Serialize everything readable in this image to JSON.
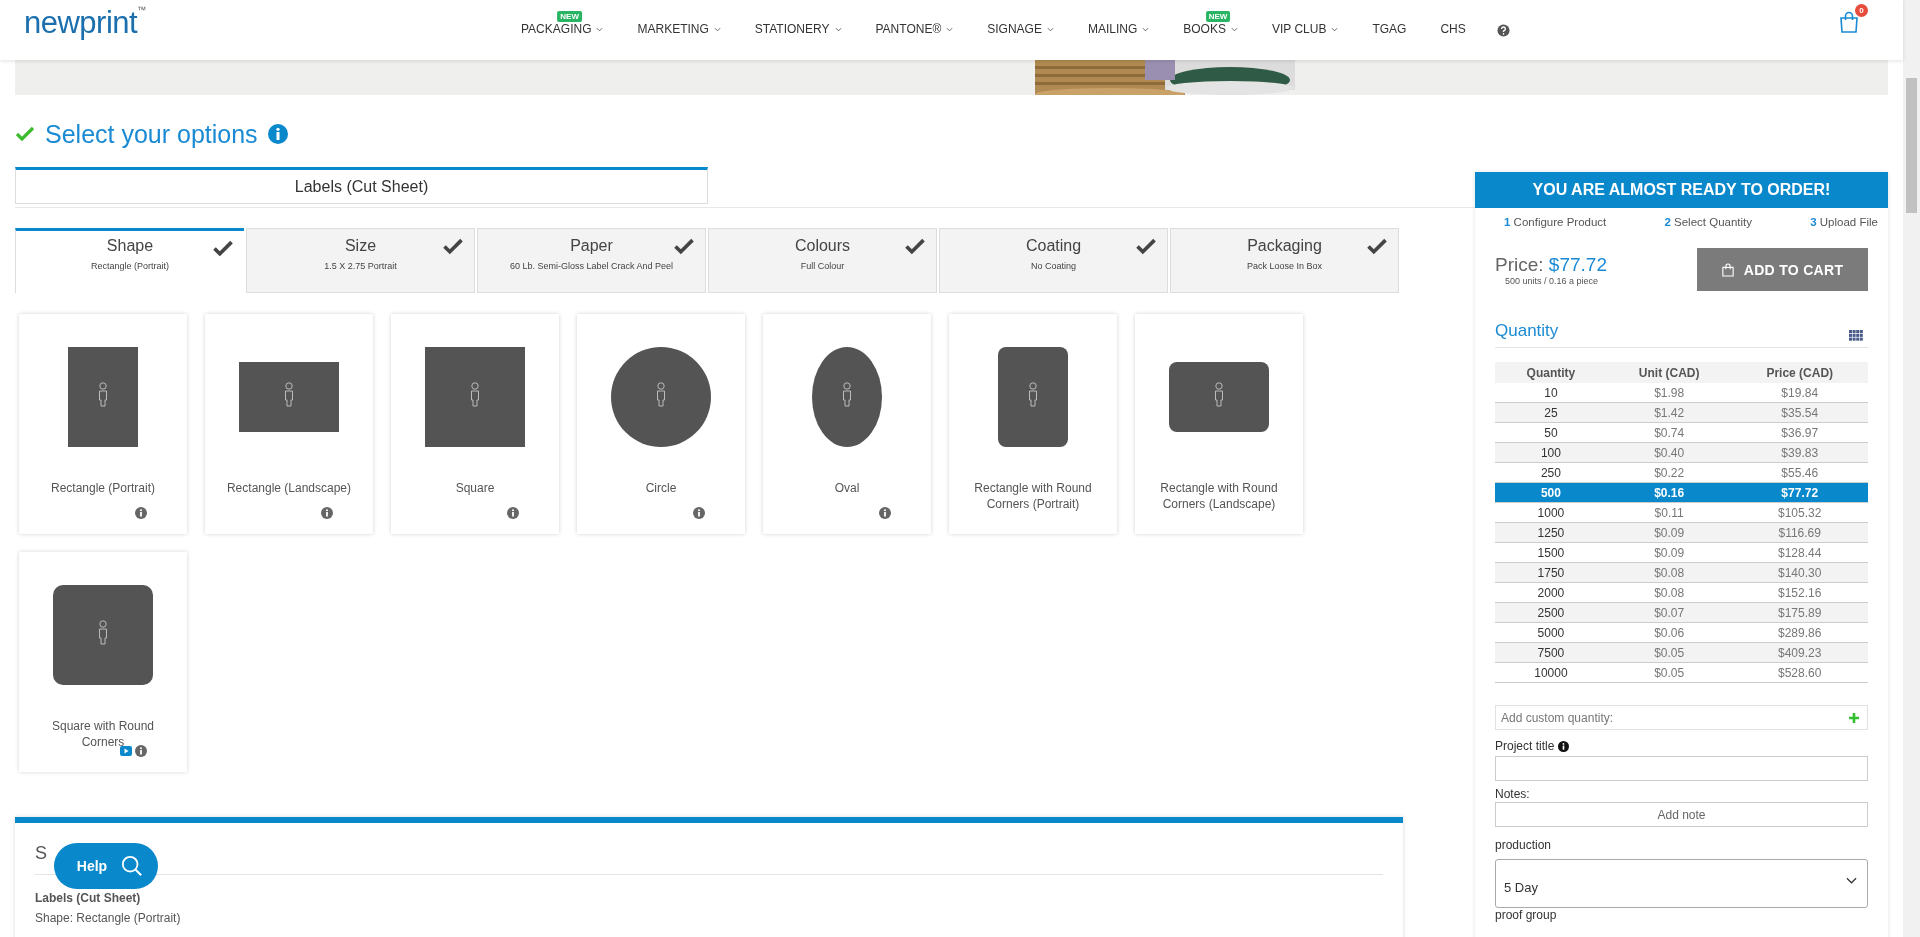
{
  "header": {
    "logo": "newprint",
    "logo_mark": "™",
    "nav": [
      {
        "label": "PACKAGING",
        "dropdown": true,
        "badge": "NEW"
      },
      {
        "label": "MARKETING",
        "dropdown": true
      },
      {
        "label": "STATIONERY",
        "dropdown": true
      },
      {
        "label": "PANTONE®",
        "dropdown": true
      },
      {
        "label": "SIGNAGE",
        "dropdown": true
      },
      {
        "label": "MAILING",
        "dropdown": true
      },
      {
        "label": "BOOKS",
        "dropdown": true,
        "badge": "NEW"
      },
      {
        "label": "VIP CLUB",
        "dropdown": true
      },
      {
        "label": "TGAG",
        "dropdown": false
      },
      {
        "label": "CHS",
        "dropdown": false
      }
    ],
    "cart_count": "0"
  },
  "options": {
    "title": "Select your options",
    "product_tab": "Labels (Cut Sheet)",
    "tabs": [
      {
        "title": "Shape",
        "value": "Rectangle (Portrait)",
        "selected": true,
        "completed": true
      },
      {
        "title": "Size",
        "value": "1.5 X 2.75 Portrait",
        "selected": false,
        "completed": true
      },
      {
        "title": "Paper",
        "value": "60 Lb. Semi-Gloss Label Crack And Peel",
        "selected": false,
        "completed": true
      },
      {
        "title": "Colours",
        "value": "Full Colour",
        "selected": false,
        "completed": true
      },
      {
        "title": "Coating",
        "value": "No Coating",
        "selected": false,
        "completed": true
      },
      {
        "title": "Packaging",
        "value": "Pack Loose In Box",
        "selected": false,
        "completed": true
      }
    ],
    "shapes": [
      {
        "label": "Rectangle (Portrait)",
        "kind": "rectangle-portrait",
        "info": true,
        "video": false
      },
      {
        "label": "Rectangle (Landscape)",
        "kind": "rectangle-landscape",
        "info": true,
        "video": false
      },
      {
        "label": "Square",
        "kind": "square",
        "info": true,
        "video": false
      },
      {
        "label": "Circle",
        "kind": "circle",
        "info": true,
        "video": false
      },
      {
        "label": "Oval",
        "kind": "oval",
        "info": true,
        "video": false
      },
      {
        "label": "Rectangle with Round Corners (Portrait)",
        "kind": "rounded-portrait",
        "info": false,
        "video": false
      },
      {
        "label": "Rectangle with Round Corners (Landscape)",
        "kind": "rounded-landscape",
        "info": false,
        "video": false
      },
      {
        "label": "Square with Round Corners",
        "kind": "rounded-square",
        "info": true,
        "video": true
      }
    ]
  },
  "summary": {
    "heading": "S",
    "product": "Labels (Cut Sheet)",
    "detail": "Shape: Rectangle (Portrait)"
  },
  "help_button": "Help",
  "order_panel": {
    "title": "YOU ARE ALMOST READY TO ORDER!",
    "steps": [
      {
        "number": "1",
        "label": "Configure Product"
      },
      {
        "number": "2",
        "label": "Select Quantity"
      },
      {
        "number": "3",
        "label": "Upload File"
      }
    ],
    "price_label": "Price:",
    "price": "$77.72",
    "price_note": "500 units / 0.16 a piece",
    "add_to_cart": "ADD TO CART",
    "quantity_title": "Quantity",
    "columns": [
      "Quantity",
      "Unit (CAD)",
      "Price (CAD)"
    ],
    "rows": [
      {
        "cells": [
          "10",
          "$1.98",
          "$19.84"
        ],
        "selected": false
      },
      {
        "cells": [
          "25",
          "$1.42",
          "$35.54"
        ],
        "selected": false
      },
      {
        "cells": [
          "50",
          "$0.74",
          "$36.97"
        ],
        "selected": false
      },
      {
        "cells": [
          "100",
          "$0.40",
          "$39.83"
        ],
        "selected": false
      },
      {
        "cells": [
          "250",
          "$0.22",
          "$55.46"
        ],
        "selected": false
      },
      {
        "cells": [
          "500",
          "$0.16",
          "$77.72"
        ],
        "selected": true
      },
      {
        "cells": [
          "1000",
          "$0.11",
          "$105.32"
        ],
        "selected": false
      },
      {
        "cells": [
          "1250",
          "$0.09",
          "$116.69"
        ],
        "selected": false
      },
      {
        "cells": [
          "1500",
          "$0.09",
          "$128.44"
        ],
        "selected": false
      },
      {
        "cells": [
          "1750",
          "$0.08",
          "$140.30"
        ],
        "selected": false
      },
      {
        "cells": [
          "2000",
          "$0.08",
          "$152.16"
        ],
        "selected": false
      },
      {
        "cells": [
          "2500",
          "$0.07",
          "$175.89"
        ],
        "selected": false
      },
      {
        "cells": [
          "5000",
          "$0.06",
          "$289.86"
        ],
        "selected": false
      },
      {
        "cells": [
          "7500",
          "$0.05",
          "$409.23"
        ],
        "selected": false
      },
      {
        "cells": [
          "10000",
          "$0.05",
          "$528.60"
        ],
        "selected": false
      }
    ],
    "custom_quantity_placeholder": "Add custom quantity:",
    "project_title_label": "Project title",
    "notes_label": "Notes:",
    "add_note": "Add note",
    "production_label": "production",
    "production_value": "5 Day",
    "next_label": "proof group"
  }
}
